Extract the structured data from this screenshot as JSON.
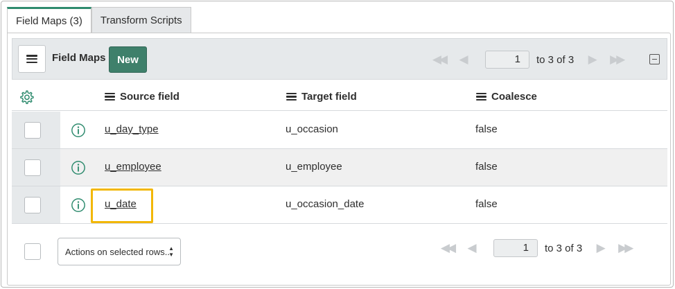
{
  "tabs": [
    {
      "label": "Field Maps (3)",
      "active": true
    },
    {
      "label": "Transform Scripts",
      "active": false
    }
  ],
  "toolbar": {
    "title": "Field Maps",
    "new_label": "New",
    "page_value": "1",
    "range_text": "to 3 of 3"
  },
  "columns": {
    "source": "Source field",
    "target": "Target field",
    "coalesce": "Coalesce"
  },
  "rows": [
    {
      "source": "u_day_type",
      "target": "u_occasion",
      "coalesce": "false"
    },
    {
      "source": "u_employee",
      "target": "u_employee",
      "coalesce": "false"
    },
    {
      "source": "u_date",
      "target": "u_occasion_date",
      "coalesce": "false"
    }
  ],
  "footer": {
    "actions_label": "Actions on selected rows...",
    "page_value": "1",
    "range_text": "to 3 of 3"
  },
  "colors": {
    "accent": "#2e8b6e",
    "new_button": "#3f806b",
    "highlight": "#f2b705"
  },
  "icons": [
    "list-menu-icon",
    "first-page-icon",
    "prev-page-icon",
    "next-page-icon",
    "last-page-icon",
    "collapse-icon",
    "gear-icon",
    "info-icon"
  ]
}
